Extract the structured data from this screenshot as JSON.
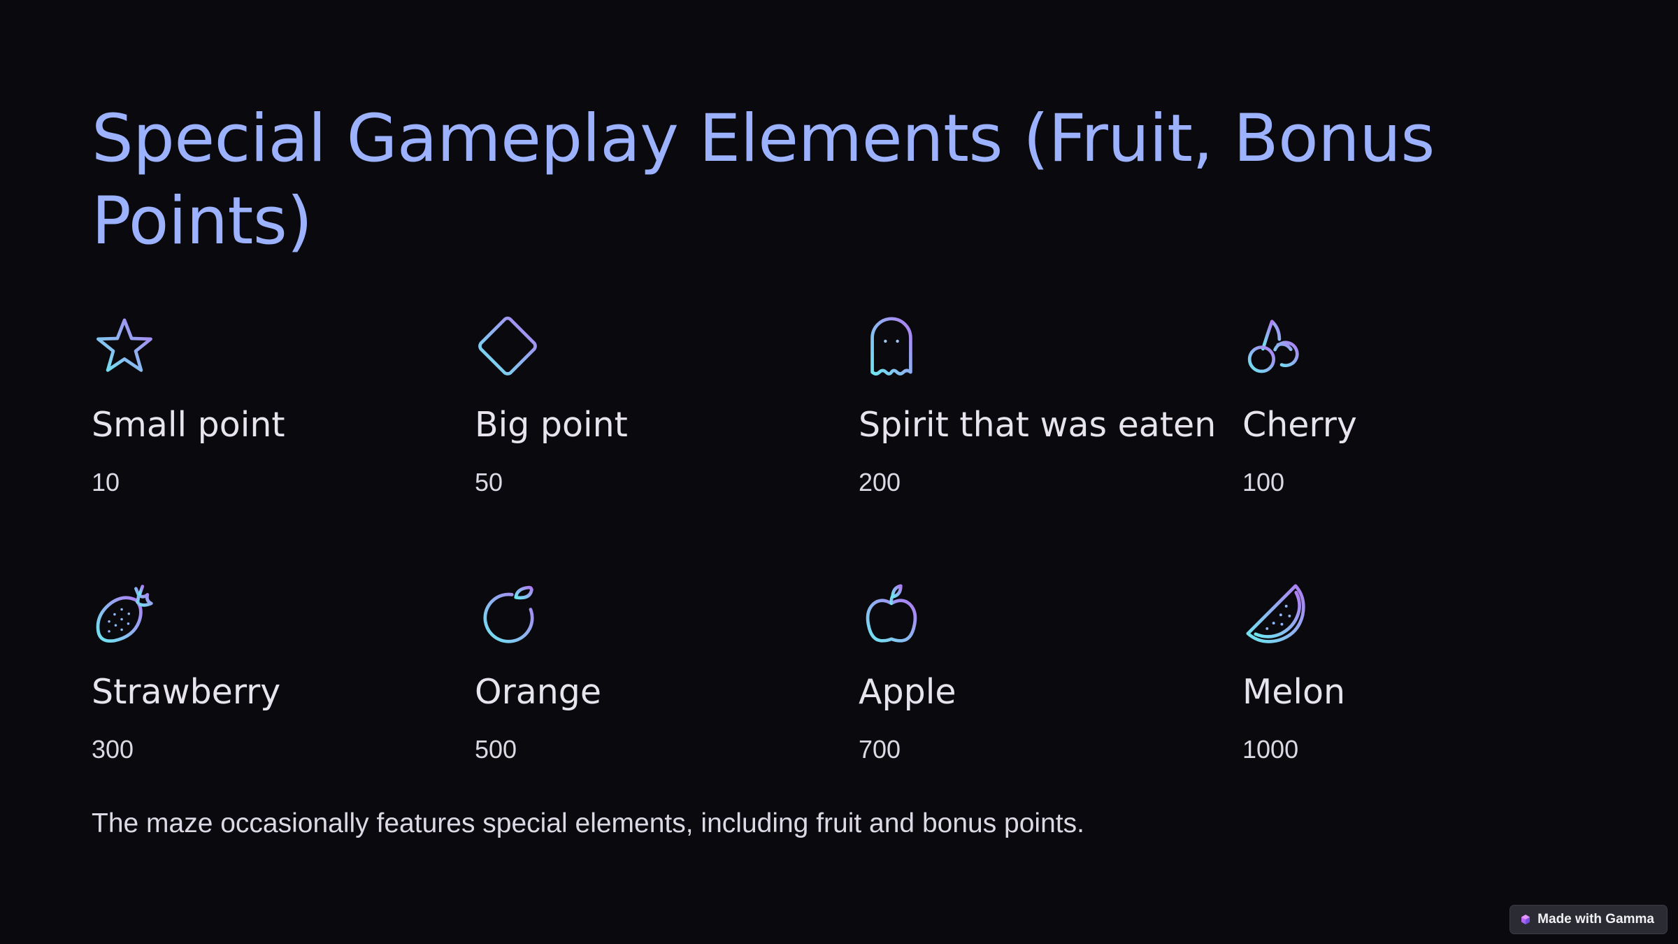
{
  "slide": {
    "title": "Special Gameplay Elements (Fruit, Bonus Points)",
    "items": [
      {
        "icon": "star-icon",
        "label": "Small point",
        "value": "10"
      },
      {
        "icon": "diamond-icon",
        "label": "Big point",
        "value": "50"
      },
      {
        "icon": "ghost-icon",
        "label": "Spirit that was eaten",
        "value": "200"
      },
      {
        "icon": "cherry-icon",
        "label": "Cherry",
        "value": "100"
      },
      {
        "icon": "strawberry-icon",
        "label": "Strawberry",
        "value": "300"
      },
      {
        "icon": "orange-icon",
        "label": "Orange",
        "value": "500"
      },
      {
        "icon": "apple-icon",
        "label": "Apple",
        "value": "700"
      },
      {
        "icon": "melon-icon",
        "label": "Melon",
        "value": "1000"
      }
    ],
    "footer": "The maze occasionally features special elements, including fruit and bonus points."
  },
  "badge": {
    "icon": "gamma-logo-icon",
    "label": "Made with Gamma"
  },
  "colors": {
    "background": "#09090e",
    "title": "#9cb2ff",
    "icon_gradient_start": "#6ee7f0",
    "icon_gradient_end": "#b07cf2",
    "text": "#e8e4ee"
  }
}
